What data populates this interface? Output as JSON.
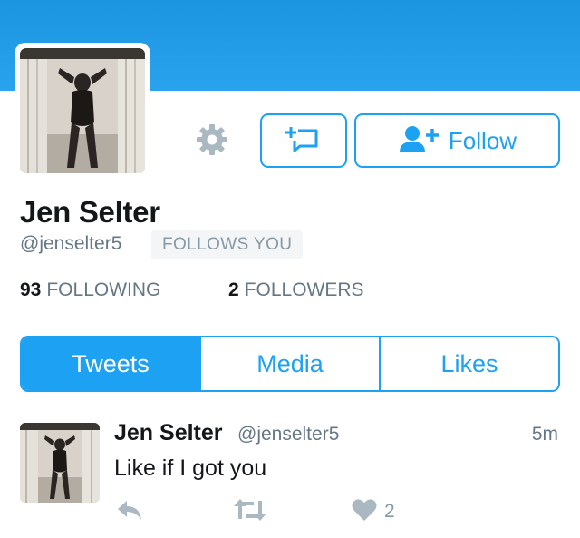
{
  "profile": {
    "name": "Jen Selter",
    "handle": "@jenselter5",
    "follows_you": "FOLLOWS YOU",
    "following_count": "93",
    "following_label": "FOLLOWING",
    "followers_count": "2",
    "followers_label": "FOLLOWERS"
  },
  "actions": {
    "follow_label": "Follow"
  },
  "tabs": [
    {
      "label": "Tweets",
      "active": true
    },
    {
      "label": "Media",
      "active": false
    },
    {
      "label": "Likes",
      "active": false
    }
  ],
  "tweet": {
    "name": "Jen Selter",
    "handle": "@jenselter5",
    "time": "5m",
    "text": "Like if I got you",
    "likes": "2"
  },
  "icons": [
    "gear-icon",
    "direct-message-icon",
    "add-user-icon",
    "reply-icon",
    "retweet-icon",
    "heart-icon"
  ],
  "colors": {
    "accent": "#1da1f2",
    "banner": "#1b95e0",
    "muted": "#657786",
    "icon_gray": "#aab8c2"
  }
}
